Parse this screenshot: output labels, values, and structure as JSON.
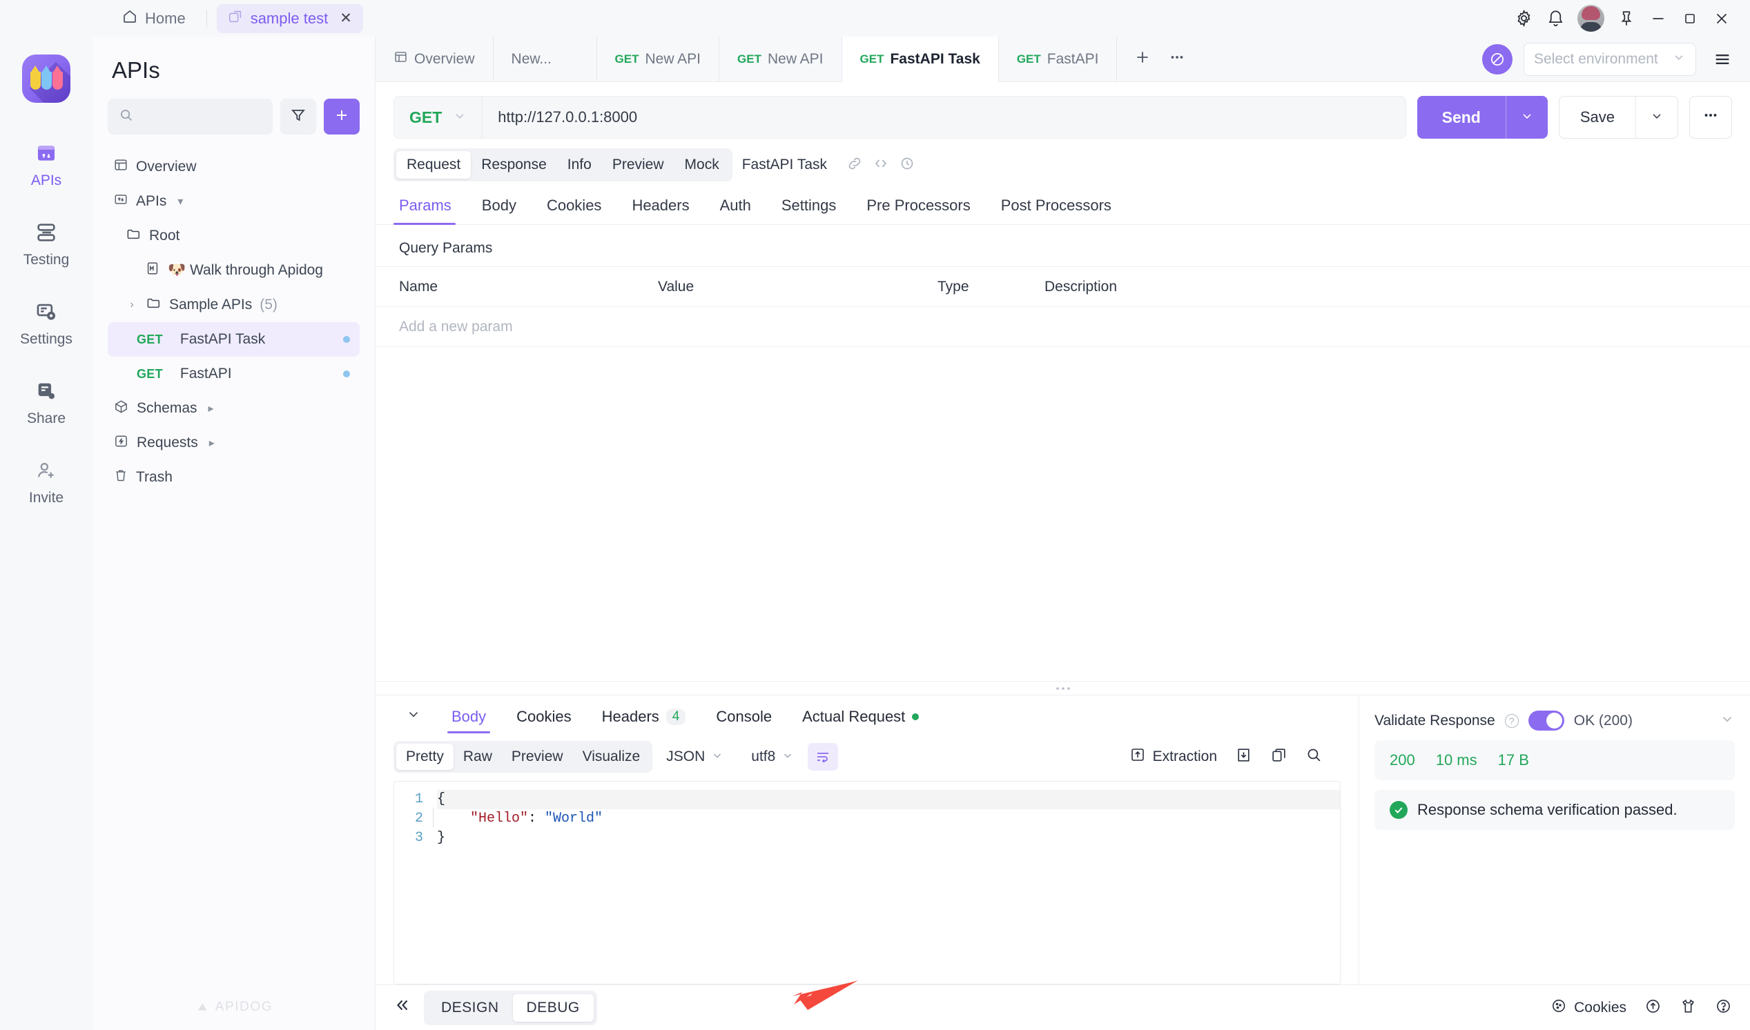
{
  "titlebar": {
    "home_label": "Home",
    "window_tab": {
      "label": "sample test",
      "close": "✕"
    },
    "icons": [
      "gear-icon",
      "bell-icon",
      "avatar",
      "pin-icon",
      "minimize-icon",
      "maximize-icon",
      "close-icon"
    ]
  },
  "rail": {
    "items": [
      {
        "label": "APIs",
        "icon": "apis-icon",
        "active": true
      },
      {
        "label": "Testing",
        "icon": "testing-icon",
        "active": false
      },
      {
        "label": "Settings",
        "icon": "settings-icon",
        "active": false
      },
      {
        "label": "Share",
        "icon": "share-icon",
        "active": false
      },
      {
        "label": "Invite",
        "icon": "invite-icon",
        "active": false
      }
    ]
  },
  "panel": {
    "title": "APIs",
    "search_placeholder": "",
    "filter_icon": "filter-icon",
    "add_icon": "plus-icon",
    "watermark": "APIDOG",
    "tree": [
      {
        "label": "Overview",
        "icon": "overview-icon",
        "indent": 0
      },
      {
        "label": "APIs",
        "icon": "apis-icon",
        "indent": 0,
        "caret": "▾"
      },
      {
        "label": "Root",
        "icon": "folder-icon",
        "indent": 1
      },
      {
        "label": "🐶 Walk through Apidog",
        "icon": "markdown-icon",
        "indent": 2
      },
      {
        "label": "Sample APIs",
        "count": "(5)",
        "icon": "folder-icon",
        "indent": 1,
        "caret": "›"
      },
      {
        "label": "FastAPI Task",
        "verb": "GET",
        "indent": 2,
        "selected": true,
        "dot": true
      },
      {
        "label": "FastAPI",
        "verb": "GET",
        "indent": 2,
        "selected": false,
        "dot": true
      },
      {
        "label": "Schemas",
        "icon": "schemas-icon",
        "indent": 0,
        "caret": "▸"
      },
      {
        "label": "Requests",
        "icon": "requests-icon",
        "indent": 0,
        "caret": "▸"
      },
      {
        "label": "Trash",
        "icon": "trash-icon",
        "indent": 0
      }
    ]
  },
  "tabbar": {
    "tabs": [
      {
        "label": "Overview",
        "icon": "overview-icon",
        "verb": "",
        "active": false
      },
      {
        "label": "New...",
        "verb": "",
        "active": false
      },
      {
        "label": "New API",
        "verb": "GET",
        "active": false
      },
      {
        "label": "New API",
        "verb": "GET",
        "active": false
      },
      {
        "label": "FastAPI Task",
        "verb": "GET",
        "active": true
      },
      {
        "label": "FastAPI",
        "verb": "GET",
        "active": false
      }
    ],
    "add_icon": "plus-icon",
    "more_icon": "ellipsis-icon",
    "env_placeholder": "Select environment",
    "env_globe_icon": "globe-icon",
    "env_menu_icon": "hamburger-icon"
  },
  "request": {
    "method": "GET",
    "url": "http://127.0.0.1:8000",
    "send_label": "Send",
    "save_label": "Save",
    "more_label": "•••",
    "pills": [
      "Request",
      "Response",
      "Info",
      "Preview",
      "Mock"
    ],
    "pill_active": "Request",
    "pill_extra": "FastAPI Task",
    "pill_icons": [
      "link-icon",
      "code-icon",
      "clock-icon"
    ],
    "subtabs": [
      "Params",
      "Body",
      "Cookies",
      "Headers",
      "Auth",
      "Settings",
      "Pre Processors",
      "Post Processors"
    ],
    "subtab_active": "Params",
    "query_params_title": "Query Params",
    "table_headers": [
      "Name",
      "Value",
      "Type",
      "Description"
    ],
    "table_placeholder": "Add a new param"
  },
  "response": {
    "collapse_caret": "∨",
    "tabs": [
      {
        "label": "Body",
        "active": true
      },
      {
        "label": "Cookies",
        "active": false
      },
      {
        "label": "Headers",
        "badge": "4",
        "active": false
      },
      {
        "label": "Console",
        "active": false
      },
      {
        "label": "Actual Request",
        "dot": true,
        "active": false
      }
    ],
    "formats": [
      "Pretty",
      "Raw",
      "Preview",
      "Visualize"
    ],
    "format_active": "Pretty",
    "content_type": "JSON",
    "charset": "utf8",
    "wrap_icon": "wrap-text-icon",
    "extraction_label": "Extraction",
    "right_icons": [
      "download-icon",
      "copy-icon",
      "search-icon"
    ],
    "code_lines": [
      "1",
      "2",
      "3"
    ],
    "code": {
      "line1": "{",
      "line2_key": "\"Hello\"",
      "line2_colon": ": ",
      "line2_value": "\"World\"",
      "line3": "}"
    },
    "validate": {
      "label": "Validate Response",
      "status_label": "OK (200)",
      "toggle_on": true,
      "status_code": "200",
      "time": "10 ms",
      "size": "17 B",
      "verification_message": "Response schema verification passed."
    }
  },
  "footer": {
    "collapse_icon": "chevron-double-left-icon",
    "modes": [
      "DESIGN",
      "DEBUG"
    ],
    "mode_active": "DEBUG",
    "cookies_label": "Cookies",
    "icons": [
      "cookie-icon",
      "upload-circle-icon",
      "shirt-icon",
      "help-icon"
    ]
  },
  "colors": {
    "accent": "#8b6bf0",
    "green": "#22a75a",
    "arrow_red": "#f4483c"
  }
}
